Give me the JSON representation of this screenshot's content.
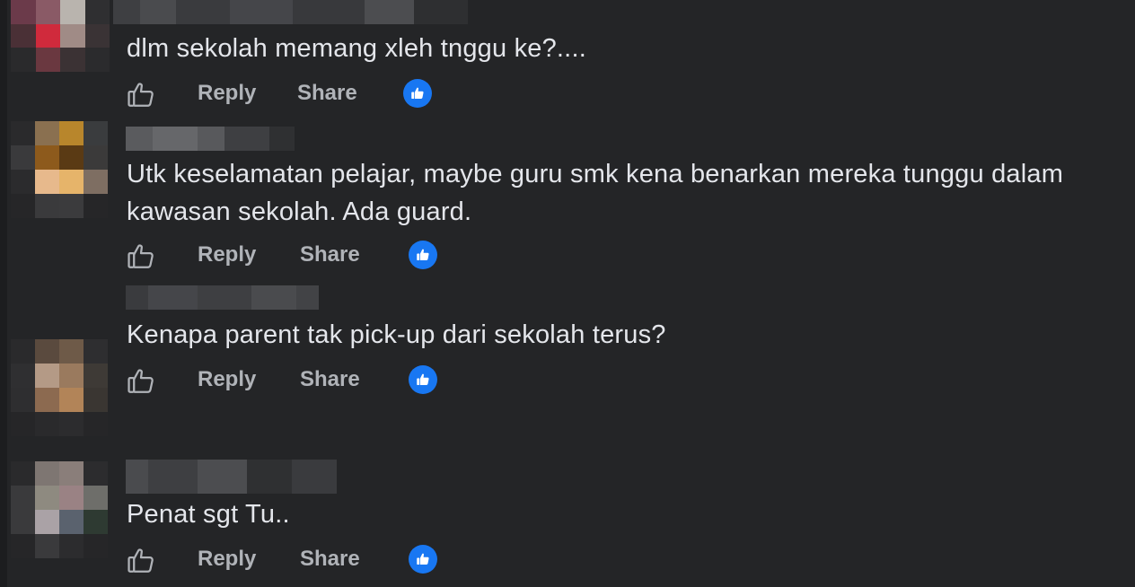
{
  "icons": {
    "like": "thumbs-up-outline-icon",
    "reaction": "like-reaction-icon"
  },
  "colors": {
    "background": "#242527",
    "text": "#e4e6eb",
    "secondary_text": "#b0b3b8",
    "reaction_blue": "#1877f2"
  },
  "comments": [
    {
      "text": "dlm sekolah memang xleh tnggu ke?....",
      "reply_label": "Reply",
      "share_label": "Share"
    },
    {
      "text": "Utk keselamatan pelajar, maybe guru smk kena benarkan mereka tunggu dalam\nkawasan sekolah. Ada guard.",
      "reply_label": "Reply",
      "share_label": "Share"
    },
    {
      "text": "Kenapa parent tak pick-up dari sekolah terus?",
      "reply_label": "Reply",
      "share_label": "Share"
    },
    {
      "text": "Penat sgt Tu..",
      "reply_label": "Reply",
      "share_label": "Share"
    }
  ]
}
